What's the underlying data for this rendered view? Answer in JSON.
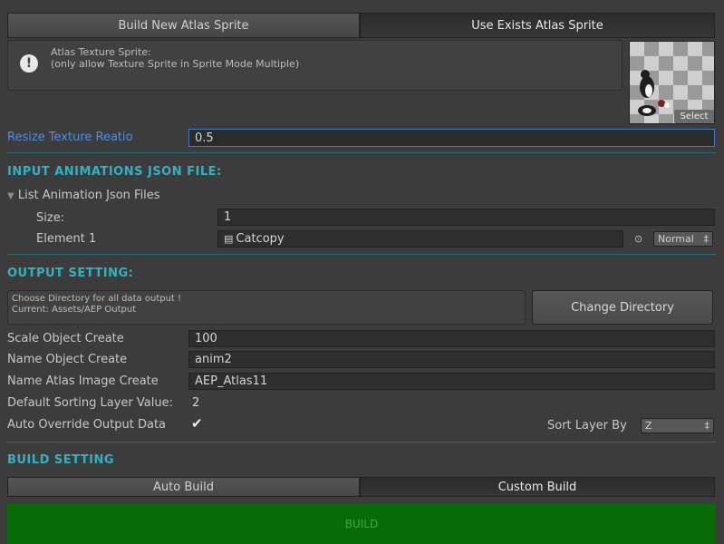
{
  "tabs": {
    "build_new": "Build New Atlas Sprite",
    "use_exists": "Use Exists Atlas Sprite"
  },
  "help": {
    "line1": "Atlas Texture Sprite:",
    "line2": "(only allow Texture Sprite in Sprite Mode Multiple)"
  },
  "thumbnail": {
    "select_label": "Select"
  },
  "resize": {
    "label": "Resize Texture Reatio",
    "value": "0.5"
  },
  "input_section": {
    "title": "INPUT ANIMATIONS JSON FILE:",
    "foldout_label": "List Animation Json Files",
    "size_label": "Size:",
    "size_value": "1",
    "element_label": "Element 1",
    "element_value": "Catcopy",
    "mode_value": "Normal"
  },
  "output_section": {
    "title": "OUTPUT SETTING:",
    "dir_line1": "Choose Directory for all data output !",
    "dir_line2": "Current: Assets/AEP Output",
    "change_dir_label": "Change Directory",
    "scale_label": "Scale Object Create",
    "scale_value": "100",
    "name_obj_label": "Name Object Create",
    "name_obj_value": "anim2",
    "name_atlas_label": "Name Atlas Image Create",
    "name_atlas_value": "AEP_Atlas11",
    "sorting_label": "Default Sorting Layer Value:",
    "sorting_value": "2",
    "override_label": "Auto Override Output Data",
    "override_checked": true,
    "sort_by_label": "Sort Layer By",
    "sort_by_value": "Z"
  },
  "build_section": {
    "title": "BUILD SETTING",
    "auto_label": "Auto Build",
    "custom_label": "Custom Build",
    "build_label": "BUILD"
  },
  "icons": {
    "warning": "exclamation-icon",
    "check": "checkmark-icon",
    "file": "file-icon",
    "target": "object-picker-icon"
  },
  "colors": {
    "section": "#2fb3c4",
    "label_focus": "#4f8fe6",
    "build": "#076b07"
  }
}
